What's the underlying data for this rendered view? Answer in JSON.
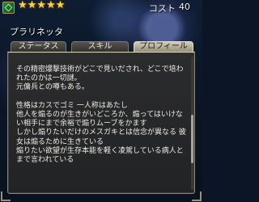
{
  "header": {
    "stars": "★★★★★",
    "cost_label": "コスト",
    "cost_value": "40"
  },
  "character": {
    "name": "プラリネッタ"
  },
  "tabs": [
    {
      "label": "ステータス",
      "active": false
    },
    {
      "label": "スキル",
      "active": false
    },
    {
      "label": "プロフィール",
      "active": true
    }
  ],
  "profile": {
    "text": "その精密爆撃技術がどこで見いだされ、どこで培われたのかは一切謎。\n元傭兵との噂もある。\n\n性格はカスでゴミ 一人称はあたし\n他人を煽るのが生きがいどころか、煽ってはいけない相手にまで余裕で煽りムーブをかます\nしかし煽りたいだけのメスガキとは信念が異なる 彼女は煽るために生きている\n煽りたい欲望が生存本能を軽く凌駕している病人とまで言われている"
  },
  "colors": {
    "star": "#f7d34a",
    "panel": "#2b2c2e",
    "active_tab": "#d2cdb8"
  }
}
